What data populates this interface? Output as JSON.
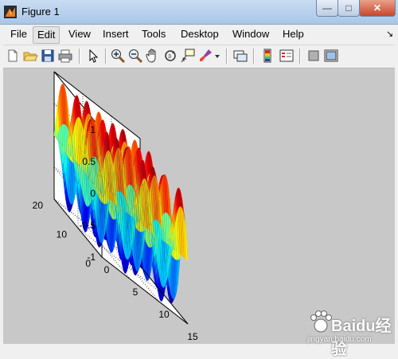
{
  "window": {
    "title": "Figure 1",
    "minimize_glyph": "—",
    "maximize_glyph": "□",
    "close_glyph": "✕"
  },
  "menu": [
    "File",
    "Edit",
    "View",
    "Insert",
    "Tools",
    "Desktop",
    "Window",
    "Help"
  ],
  "menu_active": "Edit",
  "menu_overflow_glyph": "↘",
  "toolbar_icons": [
    "new-figure-icon",
    "open-file-icon",
    "save-icon",
    "print-icon",
    "select-arrow-icon",
    "zoom-in-icon",
    "zoom-out-icon",
    "pan-hand-icon",
    "rotate-3d-icon",
    "data-cursor-icon",
    "brush-icon",
    "brush-dropdown-icon",
    "link-plot-icon",
    "insert-colorbar-icon",
    "insert-legend-icon",
    "hide-plot-tools-icon",
    "show-plot-tools-icon"
  ],
  "watermark": {
    "text": "Baidu经验",
    "sub": "jingyan.baidu.com"
  },
  "chart_data": {
    "type": "surface",
    "function": "sin(x)*sin(y)",
    "xlim": [
      0,
      15
    ],
    "ylim": [
      0,
      20
    ],
    "zlim": [
      -1,
      1
    ],
    "x_ticks": [
      0,
      5,
      10,
      15
    ],
    "y_ticks": [
      0,
      10,
      20
    ],
    "z_ticks": [
      1,
      0.5,
      0,
      -0.5,
      -1
    ],
    "x_tick_labels": [
      "0",
      "5",
      "10",
      "15"
    ],
    "y_tick_labels": [
      "0",
      "10",
      "20"
    ],
    "z_tick_labels": [
      "1",
      "0.5",
      "0",
      "-0.5",
      "-1"
    ],
    "grid": true,
    "colormap": "jet",
    "title": "",
    "xlabel": "",
    "ylabel": "",
    "zlabel": ""
  }
}
